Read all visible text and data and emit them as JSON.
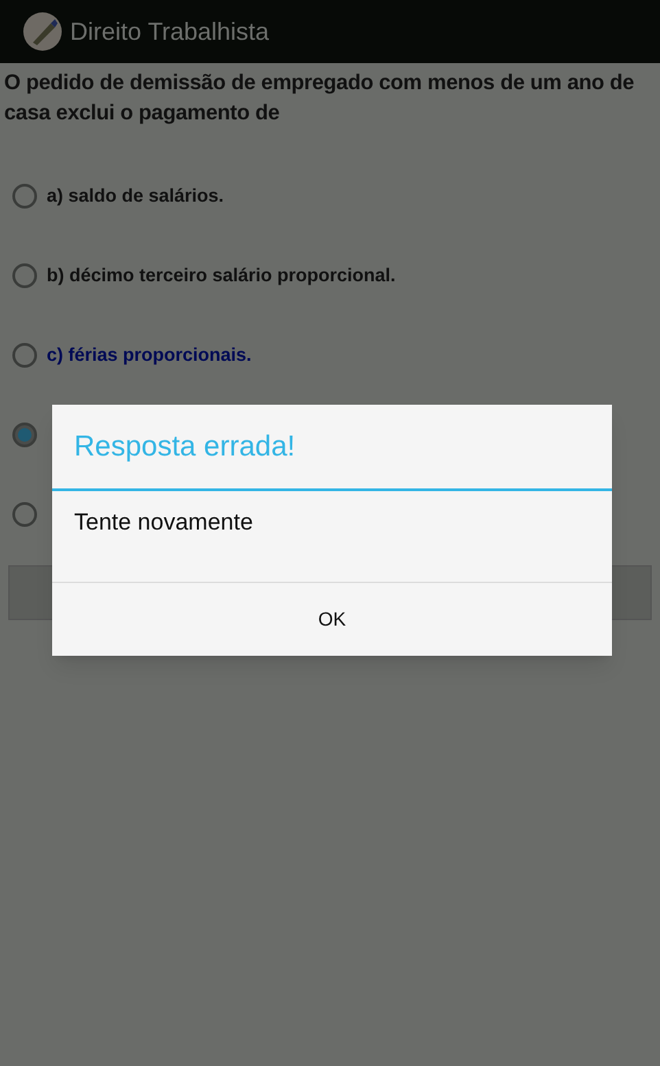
{
  "app_bar": {
    "title": "Direito Trabalhista"
  },
  "question": "O pedido de demissão de empregado com menos de um ano de casa exclui o pagamento de",
  "options": [
    {
      "label": "a) saldo de salários.",
      "selected": false,
      "color": "#111111"
    },
    {
      "label": "b) décimo terceiro salário proporcional.",
      "selected": false,
      "color": "#111111"
    },
    {
      "label": "c) férias proporcionais.",
      "selected": false,
      "color": "#000a55"
    },
    {
      "selected": true
    },
    {
      "selected": false
    }
  ],
  "dialog": {
    "title": "Resposta errada!",
    "message": "Tente novamente",
    "button": "OK"
  }
}
